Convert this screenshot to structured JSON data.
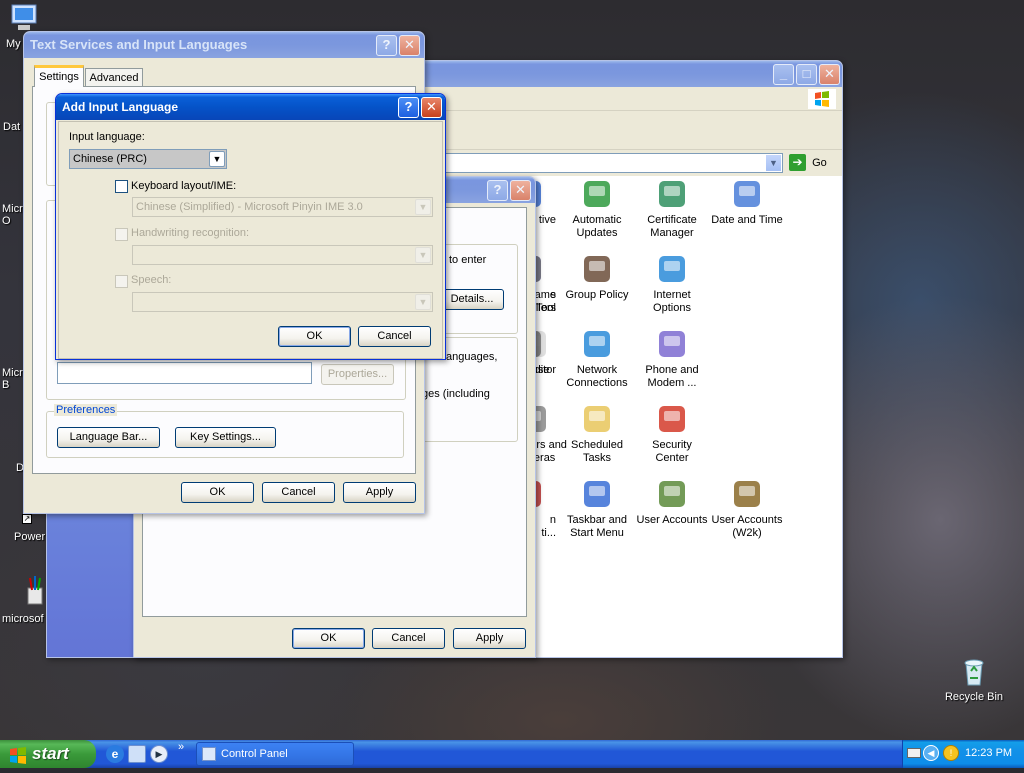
{
  "desktop": {
    "icons": [
      {
        "label": "My"
      },
      {
        "label": "Dat"
      },
      {
        "label": "Micro\nO"
      },
      {
        "label": "Micro\nB"
      },
      {
        "label": "D"
      },
      {
        "label": "Power"
      },
      {
        "label": "microsof"
      },
      {
        "label": "Recycle Bin"
      }
    ]
  },
  "control_panel": {
    "address_go": "Go",
    "items": [
      {
        "label": "tive",
        "icon": "accessibility-icon"
      },
      {
        "label": "Automatic\nUpdates",
        "icon": "windows-update-icon"
      },
      {
        "label": "Certificate\nManager",
        "icon": "certificate-icon"
      },
      {
        "label": "Date and Time",
        "icon": "clock-icon"
      },
      {
        "label": "Game\nControllers",
        "icon": "gamepad-icon"
      },
      {
        "label": "Group Policy",
        "icon": "group-policy-icon"
      },
      {
        "label": "Internet\nOptions",
        "icon": "globe-icon"
      },
      {
        "label": "s\nTool",
        "icon": "tool-icon"
      },
      {
        "label": "Mouse",
        "icon": "mouse-icon"
      },
      {
        "label": "Network\nConnections",
        "icon": "network-icon"
      },
      {
        "label": "Phone and\nModem ...",
        "icon": "phone-icon"
      },
      {
        "label": "ditor",
        "icon": "editor-icon"
      },
      {
        "label": "Scanners and\nCameras",
        "icon": "scanner-icon"
      },
      {
        "label": "Scheduled\nTasks",
        "icon": "scheduled-tasks-icon"
      },
      {
        "label": "Security\nCenter",
        "icon": "shield-icon"
      },
      {
        "label": "n\nti...",
        "icon": "partial-icon"
      },
      {
        "label": "Taskbar and\nStart Menu",
        "icon": "taskbar-icon"
      },
      {
        "label": "User Accounts",
        "icon": "users-icon"
      },
      {
        "label": "User Accounts\n(W2k)",
        "icon": "users-key-icon"
      }
    ]
  },
  "regional_dialog": {
    "text_fragments": [
      "to enter",
      "anguages,",
      "ges (including"
    ],
    "details_button": "Details...",
    "ok": "OK",
    "cancel": "Cancel",
    "apply": "Apply"
  },
  "text_services": {
    "title": "Text Services and Input Languages",
    "tabs": [
      "Settings",
      "Advanced"
    ],
    "properties_button": "Properties...",
    "preferences_label": "Preferences",
    "language_bar_button": "Language Bar...",
    "key_settings_button": "Key Settings...",
    "ok": "OK",
    "cancel": "Cancel",
    "apply": "Apply"
  },
  "add_input_language": {
    "title": "Add Input Language",
    "input_language_label": "Input language:",
    "input_language_value": "Chinese (PRC)",
    "keyboard_label": "Keyboard layout/IME:",
    "keyboard_checked": false,
    "keyboard_value": "Chinese (Simplified) - Microsoft Pinyin IME 3.0",
    "handwriting_label": "Handwriting recognition:",
    "speech_label": "Speech:",
    "ok": "OK",
    "cancel": "Cancel"
  },
  "taskbar": {
    "start_label": "start",
    "task_label": "Control Panel",
    "clock": "12:23 PM"
  }
}
